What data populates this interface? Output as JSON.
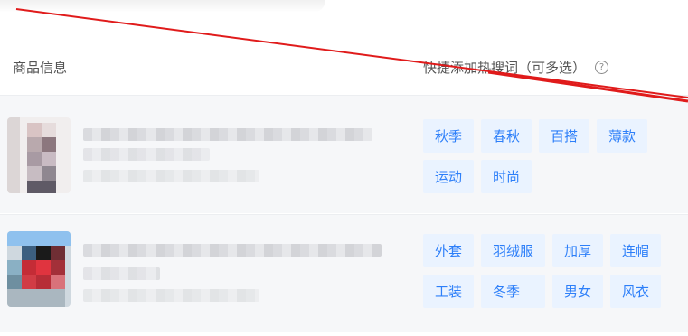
{
  "header": {
    "product_col": "商品信息",
    "keywords_col": "快捷添加热搜词（可多选）",
    "help_symbol": "?"
  },
  "rows": [
    {
      "tags": [
        "秋季",
        "春秋",
        "百搭",
        "薄款",
        "运动",
        "时尚"
      ]
    },
    {
      "tags": [
        "外套",
        "羽绒服",
        "加厚",
        "连帽",
        "工装",
        "冬季",
        "男女",
        "风衣"
      ]
    }
  ],
  "colors": {
    "tag_bg": "#eaf3ff",
    "tag_text": "#2d7ff9",
    "row_bg": "#f6f7f9",
    "annotation_line": "#e01b1b"
  }
}
